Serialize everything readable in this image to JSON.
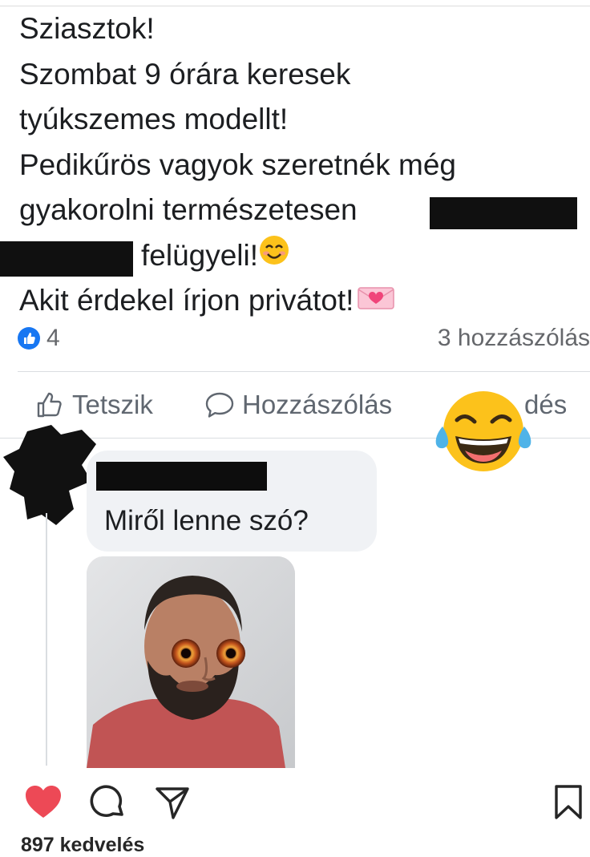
{
  "post": {
    "lines": [
      "Sziasztok!",
      "Szombat 9 órára keresek",
      "tyúkszemes modellt!",
      "Pedikűrös vagyok szeretnék még",
      "gyakorolni természetesen",
      "felügyeli!",
      "Akit érdekel írjon privátot!"
    ],
    "smile_emoji": "😊",
    "love_letter_emoji": "💌"
  },
  "reactions": {
    "like_count": "4",
    "comment_count": "3 hozzászólás"
  },
  "actions": {
    "like_label": "Tetszik",
    "comment_label": "Hozzászólás",
    "share_label_visible": "dés"
  },
  "comment": {
    "text": "Miről lenne szó?"
  },
  "instagram": {
    "likes_text": "897 kedvelés"
  },
  "colors": {
    "facebook_blue": "#1877f2",
    "instagram_red": "#ed4956",
    "bubble_gray": "#f0f2f5"
  },
  "icons": [
    "like-icon",
    "thumbs-up-icon",
    "speech-bubble-icon",
    "laughing-tears-emoji",
    "heart-icon",
    "comment-icon",
    "send-icon",
    "bookmark-icon"
  ]
}
